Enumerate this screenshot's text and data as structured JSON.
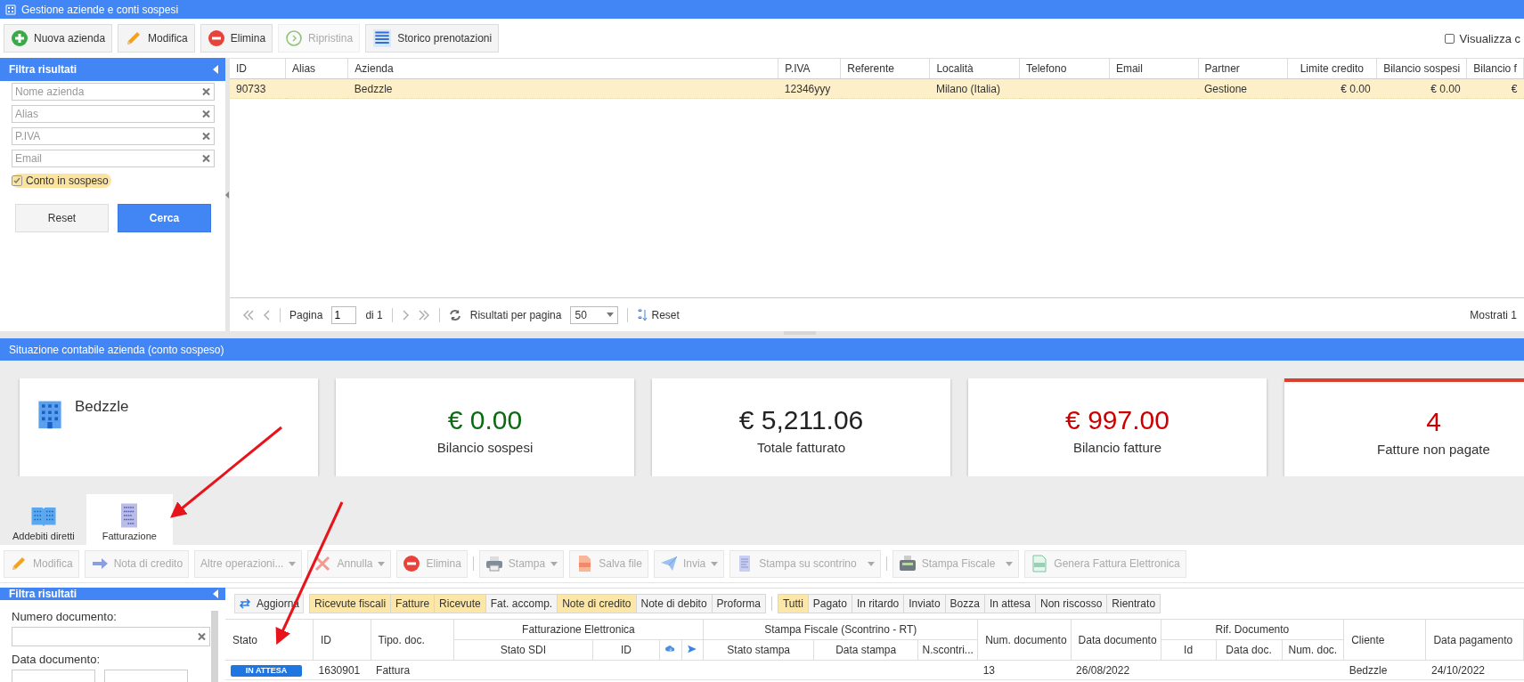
{
  "window": {
    "title": "Gestione aziende e conti sospesi"
  },
  "toolbar": [
    {
      "label": "Nuova azienda",
      "kind": "add",
      "disabled": false
    },
    {
      "label": "Modifica",
      "kind": "edit",
      "disabled": false
    },
    {
      "label": "Elimina",
      "kind": "delete",
      "disabled": false
    },
    {
      "label": "Ripristina",
      "kind": "restore",
      "disabled": true
    },
    {
      "label": "Storico prenotazioni",
      "kind": "list",
      "disabled": false
    }
  ],
  "show_all": {
    "label": "Visualizza c",
    "checked": false
  },
  "filter": {
    "title": "Filtra risultati",
    "fields": [
      {
        "placeholder": "Nome azienda"
      },
      {
        "placeholder": "Alias"
      },
      {
        "placeholder": "P.IVA"
      },
      {
        "placeholder": "Email"
      }
    ],
    "suspended": {
      "label": "Conto in sospeso",
      "checked": true
    },
    "buttons": [
      {
        "label": "Reset",
        "kind": "secondary"
      },
      {
        "label": "Cerca",
        "kind": "primary"
      }
    ]
  },
  "companies": {
    "rows": [
      {
        "selected": true
      }
    ],
    "columns": [
      {
        "label": "ID",
        "cells": [
          "90733"
        ]
      },
      {
        "label": "Alias"
      },
      {
        "label": "Azienda",
        "cells": [
          "Bedzzle"
        ]
      },
      {
        "label": "P.IVA",
        "cells": [
          "12346yyy"
        ]
      },
      {
        "label": "Referente"
      },
      {
        "label": "Località",
        "cells": [
          "Milano (Italia)"
        ]
      },
      {
        "label": "Telefono"
      },
      {
        "label": "Email"
      },
      {
        "label": "Partner",
        "cells": [
          "Gestione"
        ]
      },
      {
        "label": "Limite credito",
        "kind": "amount",
        "cells": [
          "€ 0.00"
        ]
      },
      {
        "label": "Bilancio sospesi",
        "kind": "amount",
        "cells": [
          "€ 0.00"
        ]
      },
      {
        "label": "Bilancio f",
        "kind": "amount",
        "cells": [
          "€"
        ]
      }
    ]
  },
  "pager": {
    "page_label": "Pagina",
    "page": "1",
    "of": "di 1",
    "per_page_label": "Risultati per pagina",
    "per_page": "50",
    "reset": "Reset",
    "shown": "Mostrati 1"
  },
  "summary": {
    "title": "Situazione contabile azienda (conto sospeso)",
    "company": "Bedzzle",
    "cards": [
      {
        "value": "€ 0.00",
        "label": "Bilancio sospesi",
        "color": "#0a6b12",
        "alert": false
      },
      {
        "value": "€ 5,211.06",
        "label": "Totale fatturato",
        "color": "#222222",
        "alert": false
      },
      {
        "value": "€ 997.00",
        "label": "Bilancio fatture",
        "color": "#cc0000",
        "alert": false
      },
      {
        "value": "4",
        "label": "Fatture non pagate",
        "color": "#cc0000",
        "alert": true
      }
    ]
  },
  "tabs": [
    {
      "label": "Addebiti diretti",
      "kind": "book",
      "selected": false
    },
    {
      "label": "Fatturazione",
      "kind": "doc",
      "selected": true
    }
  ],
  "doc_toolbar": [
    {
      "buttons": [
        {
          "label": "Modifica",
          "kind": "edit",
          "dropdown": false
        },
        {
          "label": "Nota di credito",
          "kind": "arrow",
          "dropdown": false
        },
        {
          "label": "Altre operazioni...",
          "kind": "plain",
          "dropdown": true
        },
        {
          "label": "Annulla",
          "kind": "cross",
          "dropdown": true
        },
        {
          "label": "Elimina",
          "kind": "delete",
          "dropdown": false
        }
      ]
    },
    {
      "buttons": [
        {
          "label": "Stampa",
          "kind": "printer",
          "dropdown": true
        },
        {
          "label": "Salva file",
          "kind": "pdf",
          "dropdown": false
        },
        {
          "label": "Invia",
          "kind": "plane",
          "dropdown": true
        },
        {
          "label": "Stampa su scontrino",
          "kind": "receipt",
          "dropdown": true
        }
      ]
    },
    {
      "buttons": [
        {
          "label": "Stampa Fiscale",
          "kind": "register",
          "dropdown": true
        },
        {
          "label": "Genera Fattura Elettronica",
          "kind": "xml",
          "dropdown": false
        }
      ]
    }
  ],
  "doc_filter": {
    "title": "Filtra risultati",
    "fields": [
      {
        "label": "Numero documento:",
        "kind": "text"
      },
      {
        "label": "Data documento:",
        "kind": "range"
      }
    ]
  },
  "refresh": "Aggiorna",
  "type_filters": [
    {
      "label": "Ricevute fiscali",
      "selected": true
    },
    {
      "label": "Fatture",
      "selected": true
    },
    {
      "label": "Ricevute",
      "selected": true
    },
    {
      "label": "Fat. accomp.",
      "selected": false
    },
    {
      "label": "Note di credito",
      "selected": true
    },
    {
      "label": "Note di debito",
      "selected": false
    },
    {
      "label": "Proforma",
      "selected": false
    }
  ],
  "status_filters": [
    {
      "label": "Tutti",
      "selected": true
    },
    {
      "label": "Pagato",
      "selected": false
    },
    {
      "label": "In ritardo",
      "selected": false
    },
    {
      "label": "Inviato",
      "selected": false
    },
    {
      "label": "Bozza",
      "selected": false
    },
    {
      "label": "In attesa",
      "selected": false
    },
    {
      "label": "Non riscosso",
      "selected": false
    },
    {
      "label": "Rientrato",
      "selected": false
    }
  ],
  "documents": {
    "columns": [
      {
        "label": "Stato",
        "kind": "status",
        "cells": [
          "IN ATTESA"
        ]
      },
      {
        "label": "ID",
        "cells": [
          "1630901"
        ]
      },
      {
        "label": "Tipo. doc.",
        "cells": [
          "Fattura"
        ]
      },
      {
        "label": "Fatturazione Elettronica",
        "children": [
          {
            "label": "Stato SDI"
          },
          {
            "label": "ID"
          },
          {
            "kind": "download"
          },
          {
            "kind": "send"
          }
        ]
      },
      {
        "label": "Stampa Fiscale (Scontrino - RT)",
        "children": [
          {
            "label": "Stato stampa"
          },
          {
            "label": "Data stampa"
          },
          {
            "label": "N.scontri..."
          }
        ]
      },
      {
        "label": "Num. documento",
        "cells": [
          "13"
        ]
      },
      {
        "label": "Data documento",
        "cells": [
          "26/08/2022"
        ]
      },
      {
        "label": "Rif. Documento",
        "children": [
          {
            "label": "Id"
          },
          {
            "label": "Data doc."
          },
          {
            "label": "Num. doc."
          }
        ]
      },
      {
        "label": "Cliente",
        "cells": [
          "Bedzzle"
        ]
      },
      {
        "label": "Data pagamento",
        "cells": [
          "24/10/2022"
        ]
      }
    ]
  }
}
